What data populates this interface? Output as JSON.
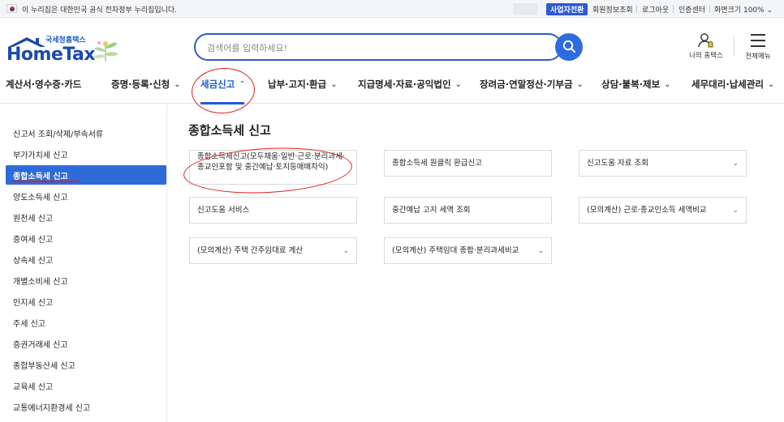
{
  "gov_bar": {
    "notice": "이 누리집은 대한민국 공식 전자정부 누리집입니다.",
    "biz_switch": "사업자전환",
    "links": [
      "회원정보조회",
      "로그아웃",
      "인증센터"
    ],
    "zoom": "화면크기 100%"
  },
  "header": {
    "logo_small": "국세청홈택스",
    "logo_main": "HomeTax",
    "search_placeholder": "검색어를 입력하세요!",
    "my_hometax": "나의 홈택스",
    "all_menu": "전체메뉴"
  },
  "nav": {
    "items": [
      {
        "label": "계산서·영수증·카드"
      },
      {
        "label": "증명·등록·신청"
      },
      {
        "label": "세금신고"
      },
      {
        "label": "납부·고지·환급"
      },
      {
        "label": "지급명세·자료·공익법인"
      },
      {
        "label": "장려금·연말정산·기부금"
      },
      {
        "label": "상담·불복·제보"
      },
      {
        "label": "세무대리·납세관리"
      }
    ],
    "active_index": 2
  },
  "sidebar": {
    "items": [
      "신고서 조회/삭제/부속서류",
      "부가가치세 신고",
      "종합소득세 신고",
      "양도소득세 신고",
      "원천세 신고",
      "증여세 신고",
      "상속세 신고",
      "개별소비세 신고",
      "인지세 신고",
      "주세 신고",
      "증권거래세 신고",
      "종합부동산세 신고",
      "교육세 신고",
      "교통에너지환경세 신고"
    ],
    "active_index": 2
  },
  "content": {
    "title": "종합소득세 신고",
    "cards": [
      {
        "label": "종합소득세신고(모두채움·일반·근로·분리과세·종교인포함 및 중간예납·토지등매매차익)",
        "dropdown": false
      },
      {
        "label": "종합소득세 원클릭 환급신고",
        "dropdown": false
      },
      {
        "label": "신고도움 자료 조회",
        "dropdown": true
      },
      {
        "label": "신고도움 서비스",
        "dropdown": false
      },
      {
        "label": "중간예납 고지 세액 조회",
        "dropdown": false
      },
      {
        "label": "(모의계산) 근로·종교인소득 세액비교",
        "dropdown": true
      },
      {
        "label": "(모의계산) 주택 간주임대료 계산",
        "dropdown": true
      },
      {
        "label": "(모의계산) 주택임대 종합·분리과세비교",
        "dropdown": true
      }
    ]
  },
  "colors": {
    "primary": "#2d6bd9",
    "annotation": "#e02020",
    "logo": "#1d4aa8"
  },
  "icons": {
    "search": "magnifier-icon",
    "my_hometax": "person-bell-icon",
    "all_menu": "hamburger-icon",
    "chevron": "chevron-down-icon"
  }
}
